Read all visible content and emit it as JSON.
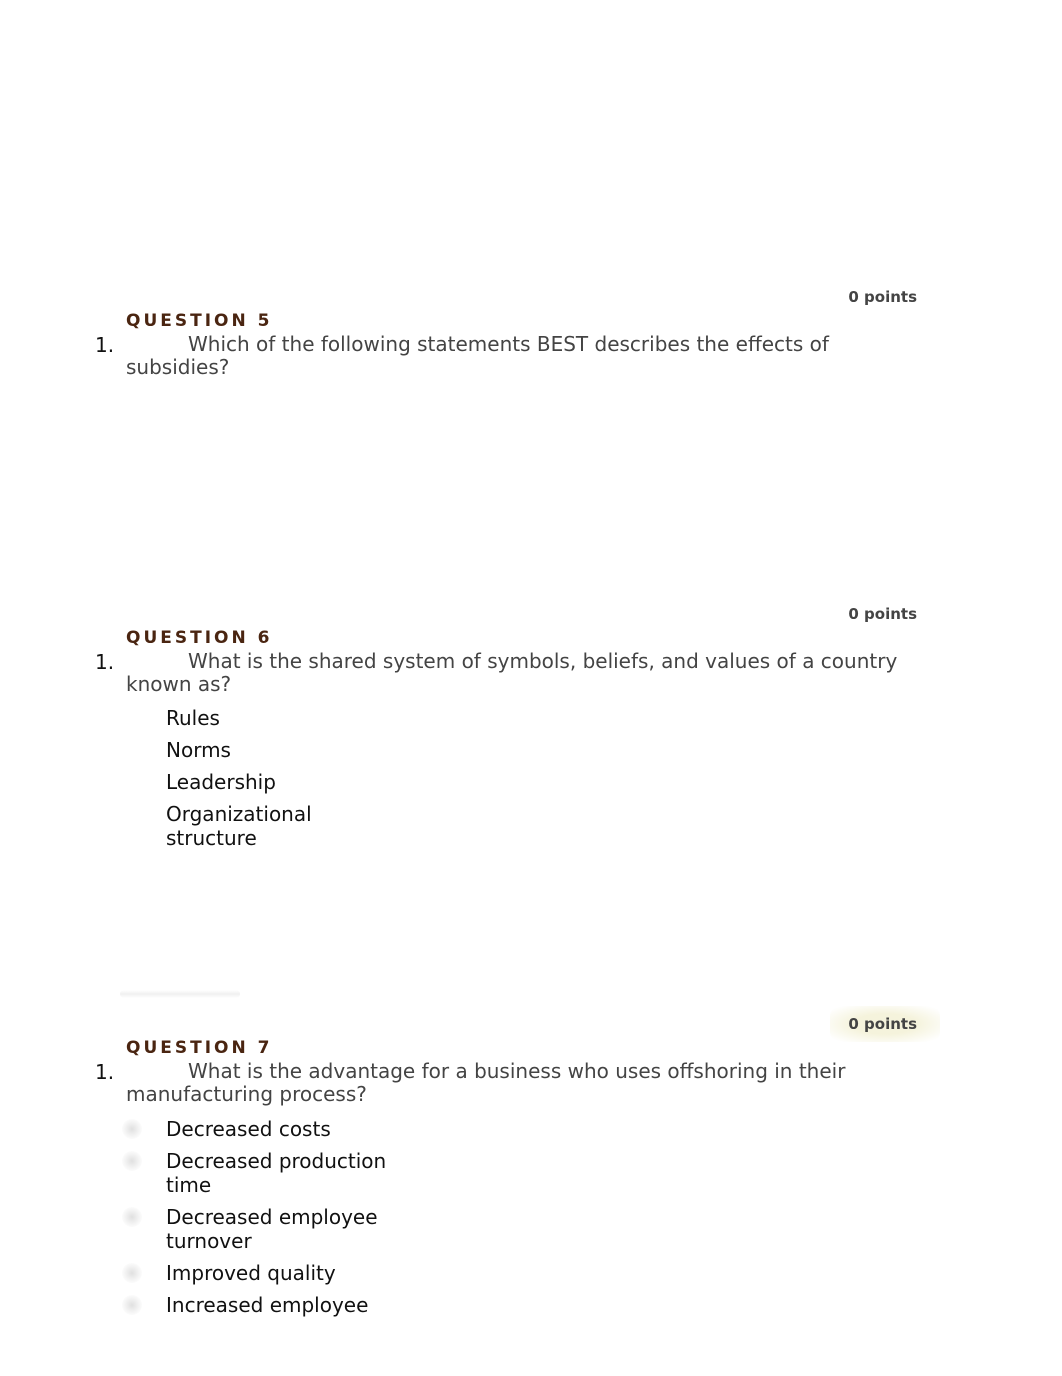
{
  "questions": [
    {
      "points": "0 points",
      "heading": "QUESTION 5",
      "number": "1.",
      "text": "Which of the following statements BEST describes the effects of subsidies?",
      "options": []
    },
    {
      "points": "0 points",
      "heading": "QUESTION 6",
      "number": "1.",
      "text": "What is the shared system of symbols, beliefs, and values of a country known as?",
      "options": [
        "Rules",
        "Norms",
        "Leadership",
        "Organizational structure"
      ]
    },
    {
      "points": "0 points",
      "heading": "QUESTION 7",
      "number": "1.",
      "text": "What is the advantage for a business who uses offshoring in their manufacturing process?",
      "options": [
        "Decreased costs",
        "Decreased production time",
        "Decreased employee turnover",
        "Improved quality",
        "Increased employee"
      ]
    }
  ]
}
